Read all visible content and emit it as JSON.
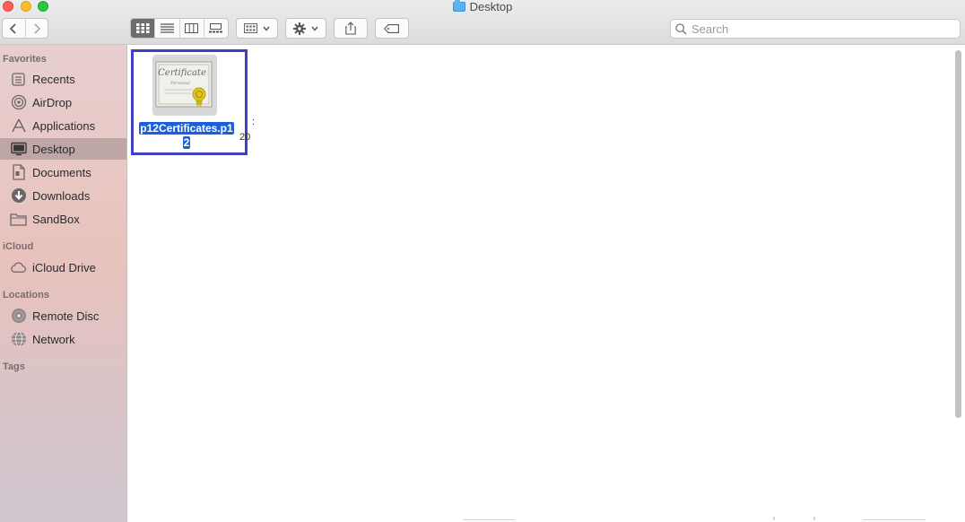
{
  "window": {
    "title": "Desktop"
  },
  "toolbar": {
    "icons": {
      "back": "chevron-left-icon",
      "forward": "chevron-right-icon",
      "view_icon": "grid-view-icon",
      "view_list": "list-view-icon",
      "view_column": "column-view-icon",
      "view_gallery": "gallery-view-icon",
      "arrange": "arrange-group-icon",
      "action": "gear-icon",
      "share": "share-icon",
      "tag": "tag-icon"
    },
    "active_view": "icon"
  },
  "search": {
    "placeholder": "Search",
    "value": ""
  },
  "sidebar": {
    "sections": [
      {
        "title": "Favorites",
        "items": [
          {
            "label": "Recents",
            "icon": "clock-icon"
          },
          {
            "label": "AirDrop",
            "icon": "airdrop-icon"
          },
          {
            "label": "Applications",
            "icon": "applications-icon"
          },
          {
            "label": "Desktop",
            "icon": "desktop-icon",
            "selected": true
          },
          {
            "label": "Documents",
            "icon": "documents-icon"
          },
          {
            "label": "Downloads",
            "icon": "downloads-icon"
          },
          {
            "label": "SandBox",
            "icon": "folder-icon"
          }
        ]
      },
      {
        "title": "iCloud",
        "items": [
          {
            "label": "iCloud Drive",
            "icon": "cloud-icon"
          }
        ]
      },
      {
        "title": "Locations",
        "items": [
          {
            "label": "Remote Disc",
            "icon": "disc-icon"
          },
          {
            "label": "Network",
            "icon": "globe-icon"
          }
        ]
      },
      {
        "title": "Tags",
        "items": []
      }
    ]
  },
  "files": [
    {
      "name_line1": "p12Certificates.p1",
      "name_line2": "2",
      "icon": "certificate-icon",
      "selected": true
    }
  ],
  "partial_texts": {
    "peek_top": ":",
    "peek_bottom": "20"
  },
  "colors": {
    "selection_border": "#3d3fc4",
    "label_highlight": "#1d5fd8",
    "sidebar_selected": "#8a7f84"
  }
}
